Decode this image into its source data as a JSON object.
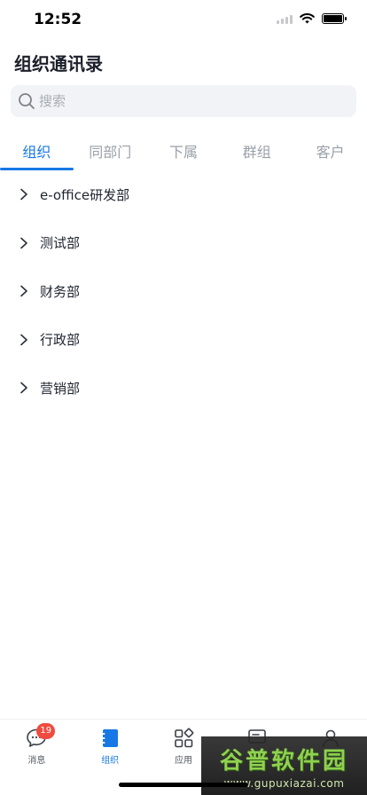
{
  "status_bar": {
    "time": "12:52"
  },
  "header": {
    "title": "组织通讯录"
  },
  "search": {
    "placeholder": "搜索",
    "value": ""
  },
  "tabs": [
    {
      "label": "组织",
      "active": true
    },
    {
      "label": "同部门",
      "active": false
    },
    {
      "label": "下属",
      "active": false
    },
    {
      "label": "群组",
      "active": false
    },
    {
      "label": "客户",
      "active": false
    }
  ],
  "departments": [
    {
      "label": "e-office研发部"
    },
    {
      "label": "测试部"
    },
    {
      "label": "财务部"
    },
    {
      "label": "行政部"
    },
    {
      "label": "营销部"
    }
  ],
  "tabbar": {
    "items": [
      {
        "label": "消息",
        "icon": "chat-bubble-icon",
        "badge": "19"
      },
      {
        "label": "组织",
        "icon": "address-book-icon",
        "active": true
      },
      {
        "label": "应用",
        "icon": "apps-grid-icon"
      },
      {
        "label": "",
        "icon": "workbench-icon"
      },
      {
        "label": "",
        "icon": "user-icon"
      }
    ]
  },
  "watermark": {
    "title": "谷普软件园",
    "url": "www.gupuxiazai.com"
  },
  "colors": {
    "accent": "#1778e5",
    "badge": "#f04b3f",
    "search_bg": "#f1f3f6"
  }
}
